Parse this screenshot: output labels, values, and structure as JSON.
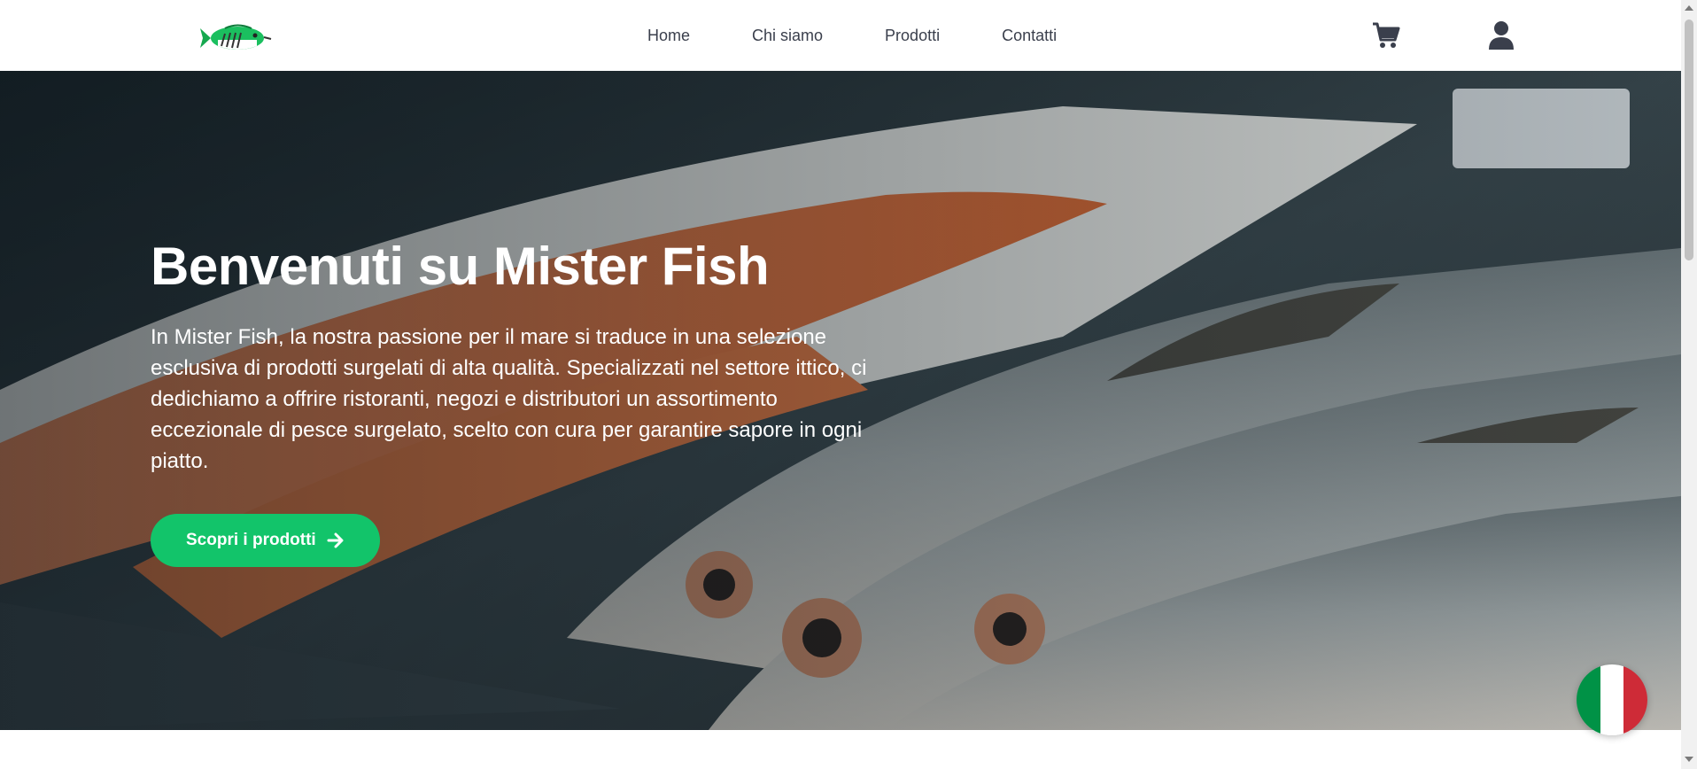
{
  "nav": {
    "logo_icon": "fish-logo-icon",
    "links": [
      "Home",
      "Chi siamo",
      "Prodotti",
      "Contatti"
    ],
    "cart_icon": "shopping-cart-icon",
    "user_icon": "user-icon"
  },
  "hero": {
    "title": "Benvenuti su Mister Fish",
    "text": "In Mister Fish, la nostra passione per il mare si traduce in una selezione esclusiva di prodotti surgelati di alta qualità. Specializzati nel settore ittico, ci dedichiamo a offrire ristoranti, negozi e distributori un assortimento eccezionale di pesce surgelato, scelto con cura per garantire sapore in ogni piatto.",
    "cta_label": "Scopri i prodotti",
    "cta_icon": "arrow-right-icon"
  },
  "language_flag": {
    "icon": "italian-flag-icon",
    "colors": [
      "#009246",
      "#ffffff",
      "#ce2b37"
    ]
  },
  "colors": {
    "accent": "#12c46a",
    "nav_text": "#3a3f4c"
  }
}
